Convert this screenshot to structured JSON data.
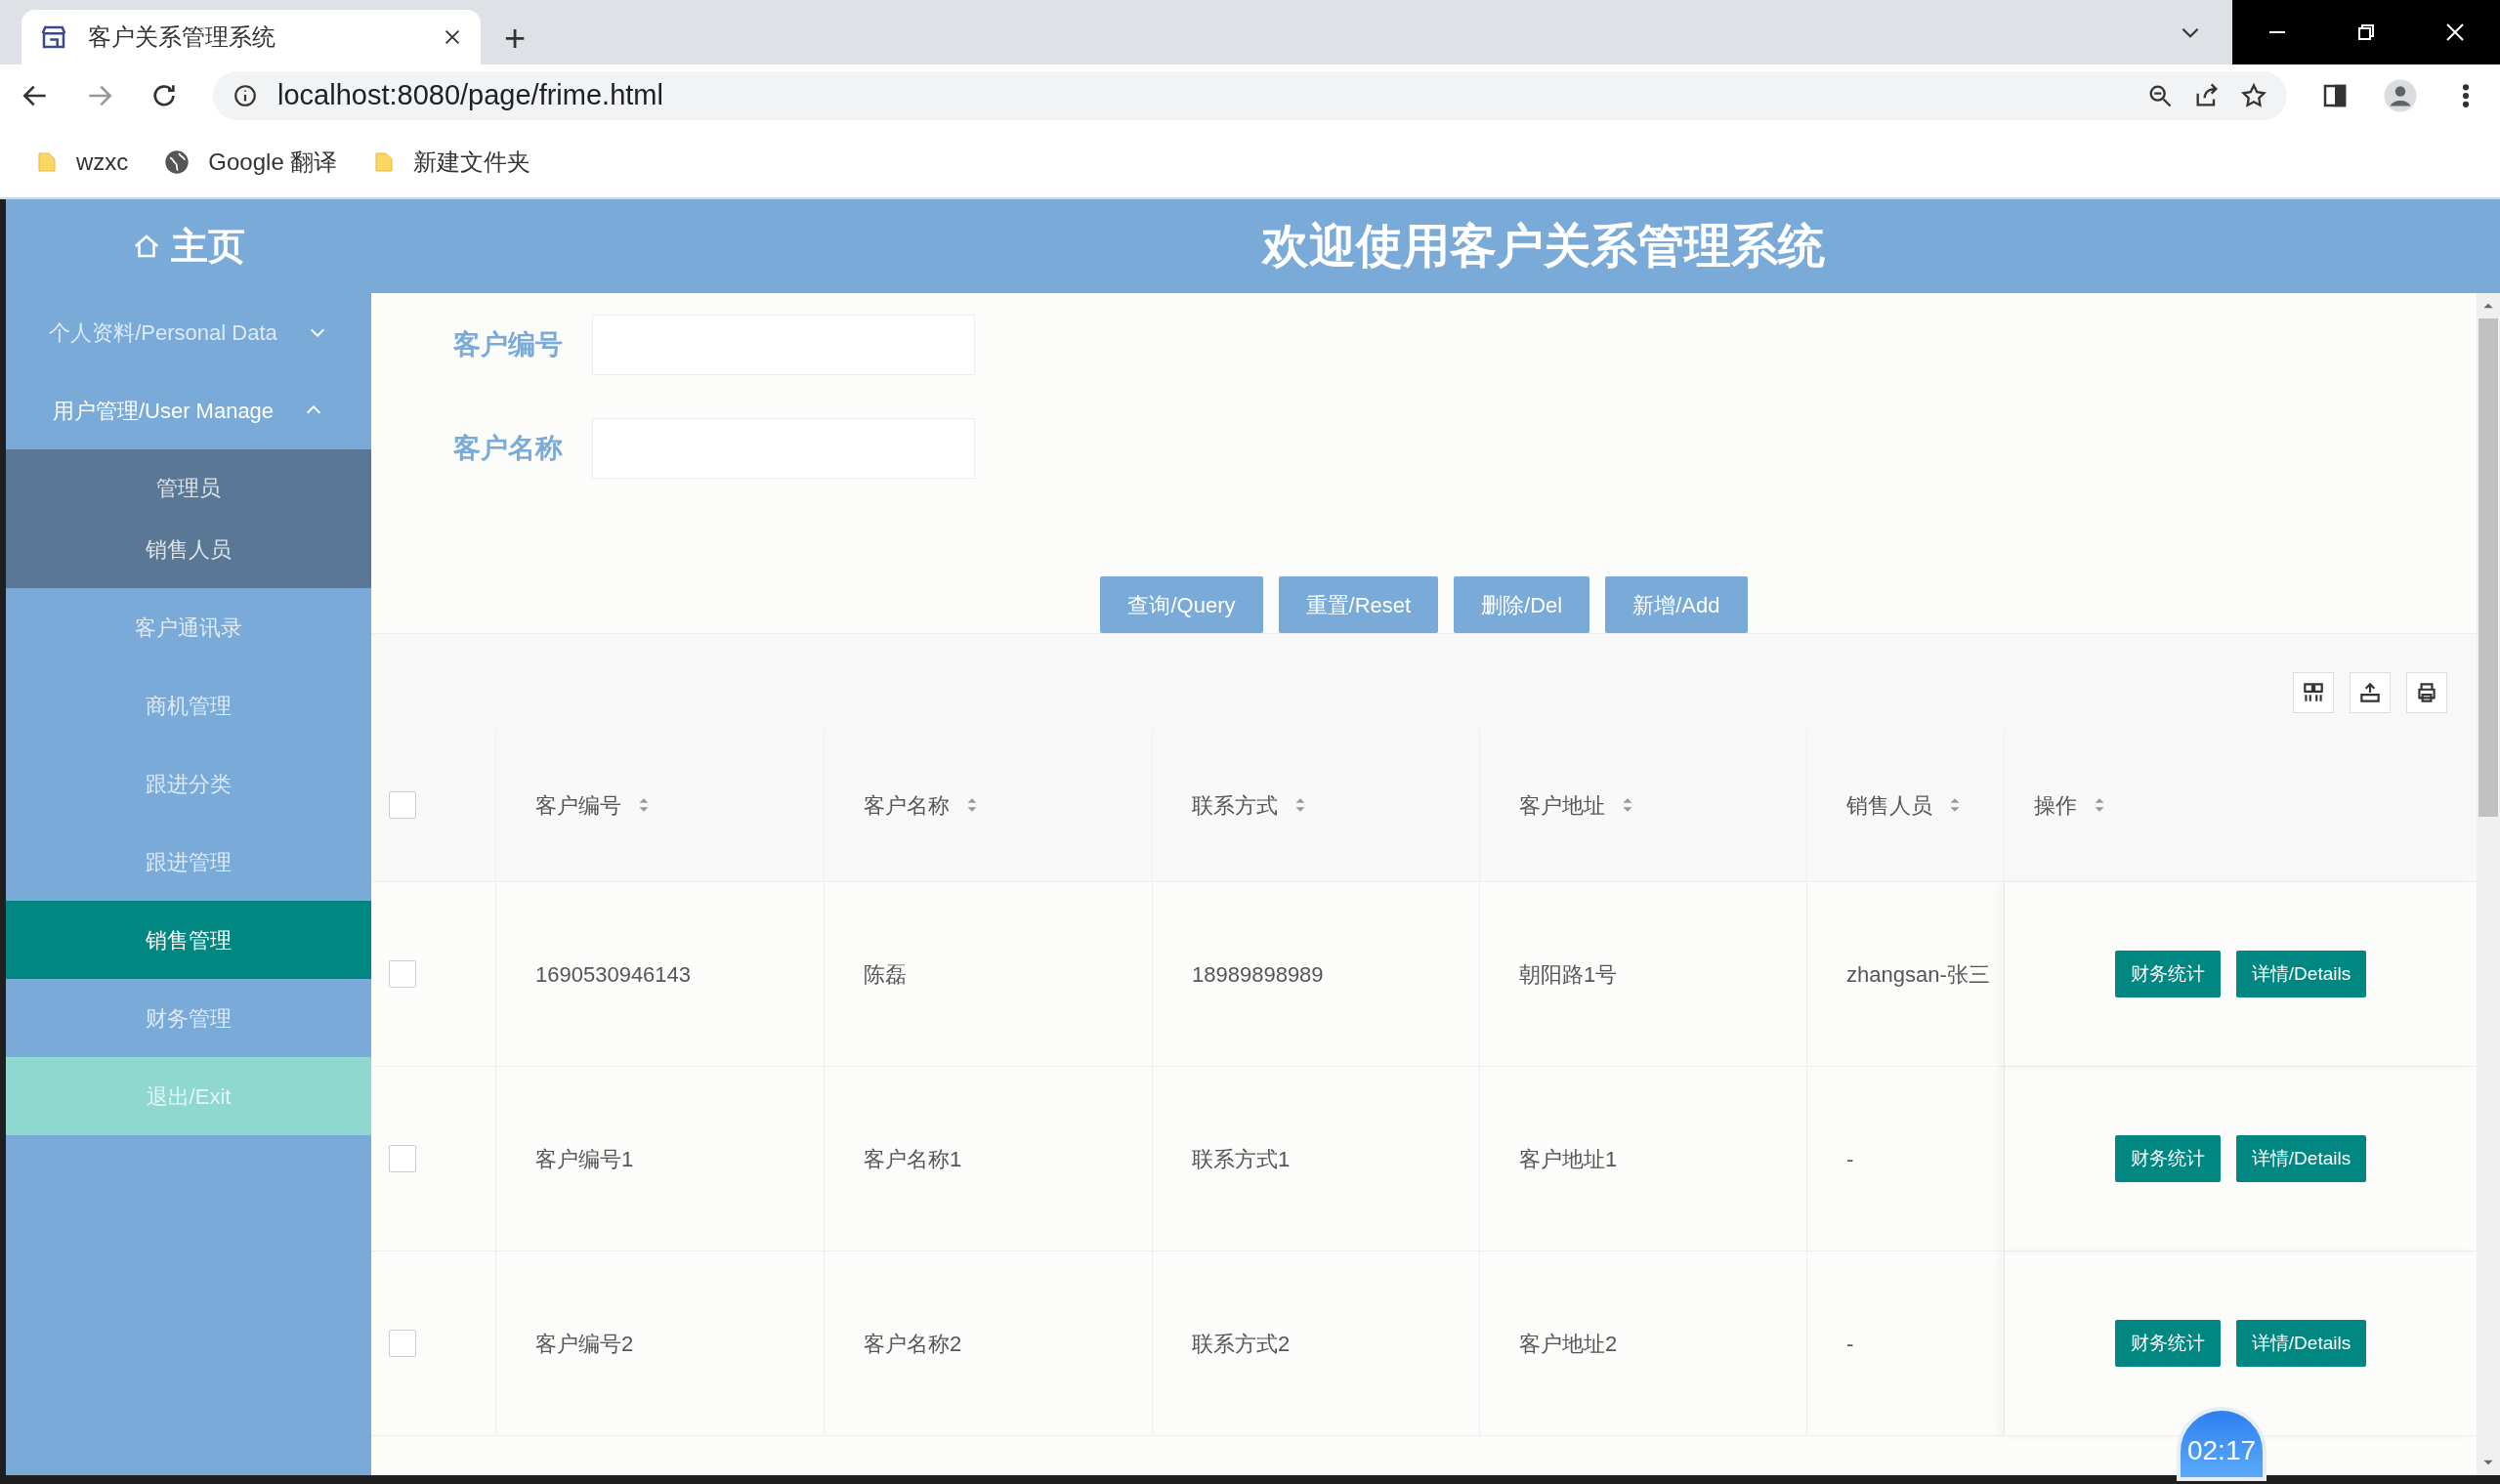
{
  "browser": {
    "tab_title": "客户关系管理系统",
    "new_tab": "+",
    "url": "localhost:8080/page/frime.html",
    "bookmarks": [
      {
        "kind": "folder",
        "label": "wzxc"
      },
      {
        "kind": "globe",
        "label": "Google 翻译"
      },
      {
        "kind": "folder",
        "label": "新建文件夹"
      }
    ]
  },
  "header": {
    "home": "主页",
    "title": "欢迎使用客户关系管理系统"
  },
  "sidebar": {
    "items": [
      {
        "kind": "group",
        "label": "个人资料/Personal Data",
        "expanded": false,
        "selected": false
      },
      {
        "kind": "group",
        "label": "用户管理/User Manage",
        "expanded": true,
        "selected": false,
        "children": [
          {
            "label": "管理员",
            "selected": false
          },
          {
            "label": "销售人员",
            "selected": false
          }
        ]
      },
      {
        "kind": "item",
        "label": "客户通讯录",
        "selected": false
      },
      {
        "kind": "item",
        "label": "商机管理",
        "selected": false
      },
      {
        "kind": "item",
        "label": "跟进分类",
        "selected": false
      },
      {
        "kind": "item",
        "label": "跟进管理",
        "selected": false
      },
      {
        "kind": "item",
        "label": "销售管理",
        "selected": true
      },
      {
        "kind": "item",
        "label": "财务管理",
        "selected": false
      },
      {
        "kind": "exit",
        "label": "退出/Exit",
        "selected": false
      }
    ]
  },
  "form": {
    "fields": [
      {
        "label": "客户编号"
      },
      {
        "label": "客户名称"
      }
    ],
    "buttons": [
      "查询/Query",
      "重置/Reset",
      "删除/Del",
      "新增/Add"
    ]
  },
  "table": {
    "select_all_checked": false,
    "columns": [
      "客户编号",
      "客户名称",
      "联系方式",
      "客户地址",
      "销售人员",
      "操作"
    ],
    "rows": [
      {
        "checked": false,
        "cells": [
          "1690530946143",
          "陈磊",
          "18989898989",
          "朝阳路1号",
          "zhangsan-张三"
        ],
        "actions": [
          "财务统计",
          "详情/Details"
        ]
      },
      {
        "checked": false,
        "cells": [
          "客户编号1",
          "客户名称1",
          "联系方式1",
          "客户地址1",
          "-"
        ],
        "actions": [
          "财务统计",
          "详情/Details"
        ]
      },
      {
        "checked": false,
        "cells": [
          "客户编号2",
          "客户名称2",
          "联系方式2",
          "客户地址2",
          "-"
        ],
        "actions": [
          "财务统计",
          "详情/Details"
        ]
      }
    ]
  },
  "timer": "02:17"
}
